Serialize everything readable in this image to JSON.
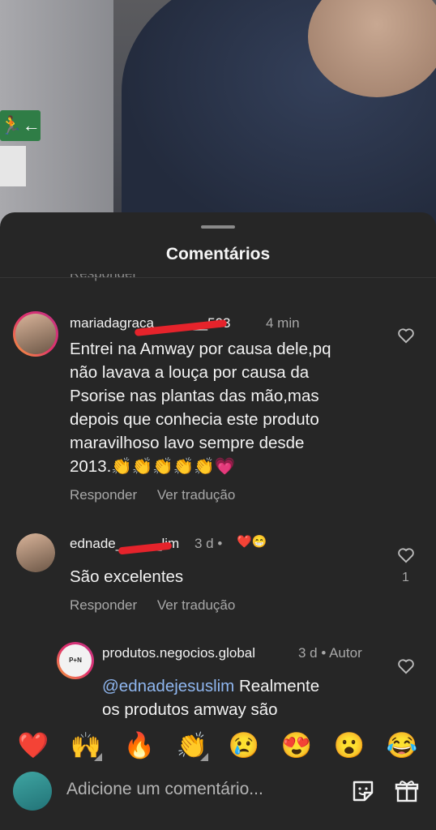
{
  "sheet": {
    "title": "Comentários",
    "partial_above": "Responder"
  },
  "comments": [
    {
      "username": "mariadagraca_______503",
      "time": "4 min",
      "text_lines": [
        "Entrei na Amway por causa dele,pq",
        "não lavava a louça por causa da",
        "Psorise nas plantas das mão,mas",
        "depois que conhecia este produto",
        "maravilhoso lavo sempre desde",
        "2013.👏👏👏👏👏💗"
      ],
      "reply": "Responder",
      "translate": "Ver tradução"
    },
    {
      "username": "ednade______lim",
      "time": "3 d •",
      "badges": "❤️😁",
      "text": "São excelentes",
      "reply": "Responder",
      "translate": "Ver tradução",
      "likes": "1"
    },
    {
      "username": "produtos.negocios.global",
      "time": "3 d • Autor",
      "mention": "@ednadejesuslim",
      "text_line1_rest": " Realmente",
      "text_line2": "os produtos amway são",
      "avatar_text": "P+N GLOBAL"
    }
  ],
  "emoji_bar": [
    "❤️",
    "🙌",
    "🔥",
    "👏",
    "😢",
    "😍",
    "😮",
    "😂"
  ],
  "input": {
    "placeholder": "Adicione um comentário..."
  },
  "icons": {
    "like": "heart-outline-icon",
    "sticker": "sticker-icon",
    "gift": "gift-icon"
  },
  "video_overlay": {
    "exit_sign": "🏃←"
  }
}
